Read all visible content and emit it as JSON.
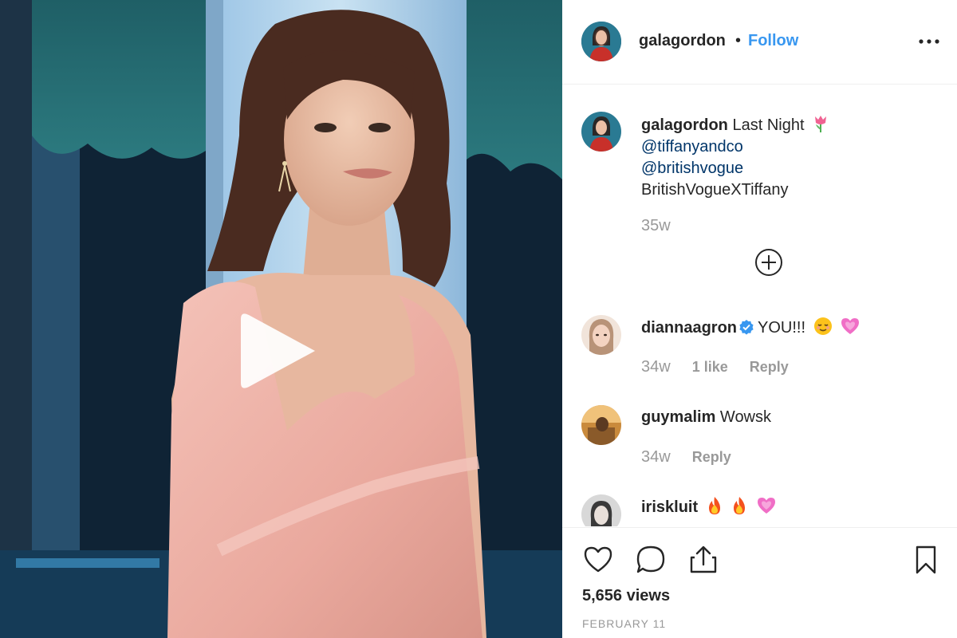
{
  "post": {
    "username": "galagordon",
    "dot": "•",
    "follow_label": "Follow",
    "more_icon": "more-horizontal-icon",
    "caption": {
      "username": "galagordon",
      "text": "Last Night",
      "text_emoji": "tulip-emoji",
      "mention_1": "@tiffanyandco",
      "mention_2": "@britishvogue",
      "tag_line": "BritishVogueXTiffany",
      "time": "35w"
    },
    "load_more_icon": "plus-circle-icon",
    "comments": [
      {
        "username": "diannaagron",
        "verified": true,
        "text": "YOU!!!",
        "emojis": [
          "relieved-face-emoji",
          "growing-heart-emoji"
        ],
        "time": "34w",
        "likes": "1 like",
        "reply": "Reply"
      },
      {
        "username": "guymalim",
        "verified": false,
        "text": "Wowsk",
        "emojis": [],
        "time": "34w",
        "likes": "",
        "reply": "Reply"
      },
      {
        "username": "iriskluit",
        "verified": false,
        "text": "",
        "emojis": [
          "fire-emoji",
          "fire-emoji",
          "growing-heart-emoji"
        ],
        "time": "",
        "likes": "",
        "reply": ""
      }
    ],
    "views": "5,656 views",
    "date": "FEBRUARY 11"
  },
  "colors": {
    "link_blue": "#3897f0",
    "mention_blue": "#003569",
    "text": "#262626",
    "muted": "#999999",
    "divider": "#efefef",
    "dress_pink": "#eeb0a6"
  }
}
